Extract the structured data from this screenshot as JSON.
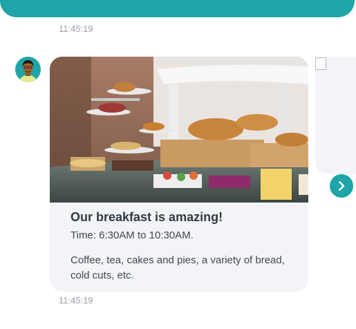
{
  "messages": {
    "first_timestamp": "11:45:19",
    "second_timestamp": "11:45:19"
  },
  "card": {
    "title": "Our breakfast is amazing!",
    "time": "Time: 6:30AM to 10:30AM.",
    "description": "Coffee, tea, cakes and pies, a variety of bread, cold cuts, etc.",
    "image_icon": "breakfast-buffet-photo"
  },
  "carousel": {
    "next_icon": "chevron-right-icon"
  },
  "colors": {
    "accent": "#1fa5a8",
    "card_background": "#f3f4f8",
    "title_text": "#2f3a44",
    "body_text": "#3e4750",
    "timestamp_text": "#9aa0a6"
  }
}
